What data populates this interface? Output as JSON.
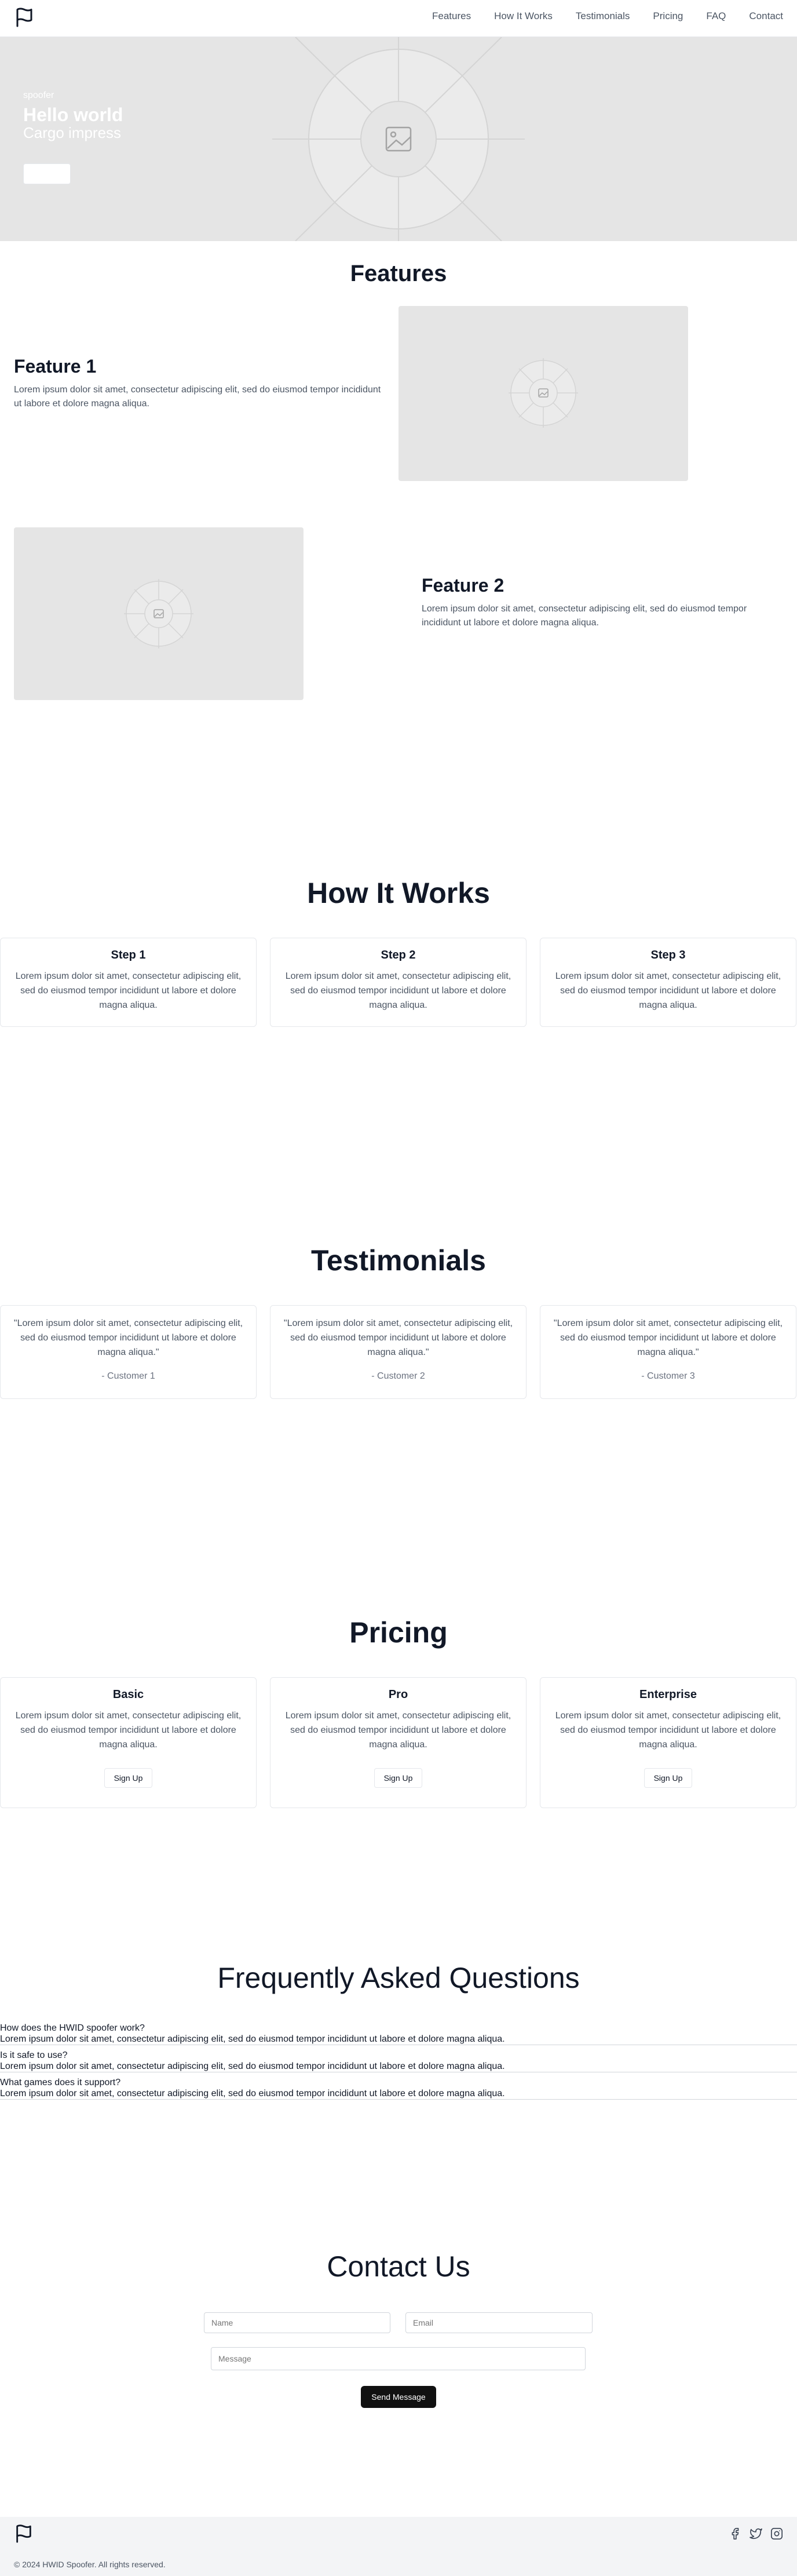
{
  "nav": {
    "links": [
      "Features",
      "How It Works",
      "Testimonials",
      "Pricing",
      "FAQ",
      "Contact"
    ]
  },
  "hero": {
    "eyebrow": "spoofer",
    "title": "Hello world",
    "subtitle": "Cargo impress",
    "cta_label": ""
  },
  "features": {
    "title": "Features",
    "items": [
      {
        "title": "Feature 1",
        "text": "Lorem ipsum dolor sit amet, consectetur adipiscing elit, sed do eiusmod tempor incididunt ut labore et dolore magna aliqua."
      },
      {
        "title": "Feature 2",
        "text": "Lorem ipsum dolor sit amet, consectetur adipiscing elit, sed do eiusmod tempor incididunt ut labore et dolore magna aliqua."
      }
    ]
  },
  "how_it_works": {
    "title": "How It Works",
    "steps": [
      {
        "title": "Step 1",
        "text": "Lorem ipsum dolor sit amet, consectetur adipiscing elit, sed do eiusmod tempor incididunt ut labore et dolore magna aliqua."
      },
      {
        "title": "Step 2",
        "text": "Lorem ipsum dolor sit amet, consectetur adipiscing elit, sed do eiusmod tempor incididunt ut labore et dolore magna aliqua."
      },
      {
        "title": "Step 3",
        "text": "Lorem ipsum dolor sit amet, consectetur adipiscing elit, sed do eiusmod tempor incididunt ut labore et dolore magna aliqua."
      }
    ]
  },
  "testimonials": {
    "title": "Testimonials",
    "items": [
      {
        "quote": "\"Lorem ipsum dolor sit amet, consectetur adipiscing elit, sed do eiusmod tempor incididunt ut labore et dolore magna aliqua.\"",
        "author": "- Customer 1"
      },
      {
        "quote": "\"Lorem ipsum dolor sit amet, consectetur adipiscing elit, sed do eiusmod tempor incididunt ut labore et dolore magna aliqua.\"",
        "author": "- Customer 2"
      },
      {
        "quote": "\"Lorem ipsum dolor sit amet, consectetur adipiscing elit, sed do eiusmod tempor incididunt ut labore et dolore magna aliqua.\"",
        "author": "- Customer 3"
      }
    ]
  },
  "pricing": {
    "title": "Pricing",
    "plans": [
      {
        "name": "Basic",
        "text": "Lorem ipsum dolor sit amet, consectetur adipiscing elit, sed do eiusmod tempor incididunt ut labore et dolore magna aliqua.",
        "button": "Sign Up"
      },
      {
        "name": "Pro",
        "text": "Lorem ipsum dolor sit amet, consectetur adipiscing elit, sed do eiusmod tempor incididunt ut labore et dolore magna aliqua.",
        "button": "Sign Up"
      },
      {
        "name": "Enterprise",
        "text": "Lorem ipsum dolor sit amet, consectetur adipiscing elit, sed do eiusmod tempor incididunt ut labore et dolore magna aliqua.",
        "button": "Sign Up"
      }
    ]
  },
  "faq": {
    "title": "Frequently Asked Questions",
    "items": [
      {
        "q": "How does the HWID spoofer work?",
        "a": "Lorem ipsum dolor sit amet, consectetur adipiscing elit, sed do eiusmod tempor incididunt ut labore et dolore magna aliqua."
      },
      {
        "q": "Is it safe to use?",
        "a": "Lorem ipsum dolor sit amet, consectetur adipiscing elit, sed do eiusmod tempor incididunt ut labore et dolore magna aliqua."
      },
      {
        "q": "What games does it support?",
        "a": "Lorem ipsum dolor sit amet, consectetur adipiscing elit, sed do eiusmod tempor incididunt ut labore et dolore magna aliqua."
      }
    ]
  },
  "contact": {
    "title": "Contact Us",
    "name_placeholder": "Name",
    "email_placeholder": "Email",
    "message_placeholder": "Message",
    "send_label": "Send Message"
  },
  "footer": {
    "copyright": "© 2024 HWID Spoofer. All rights reserved.",
    "social": [
      "facebook-icon",
      "twitter-icon",
      "instagram-icon"
    ]
  }
}
